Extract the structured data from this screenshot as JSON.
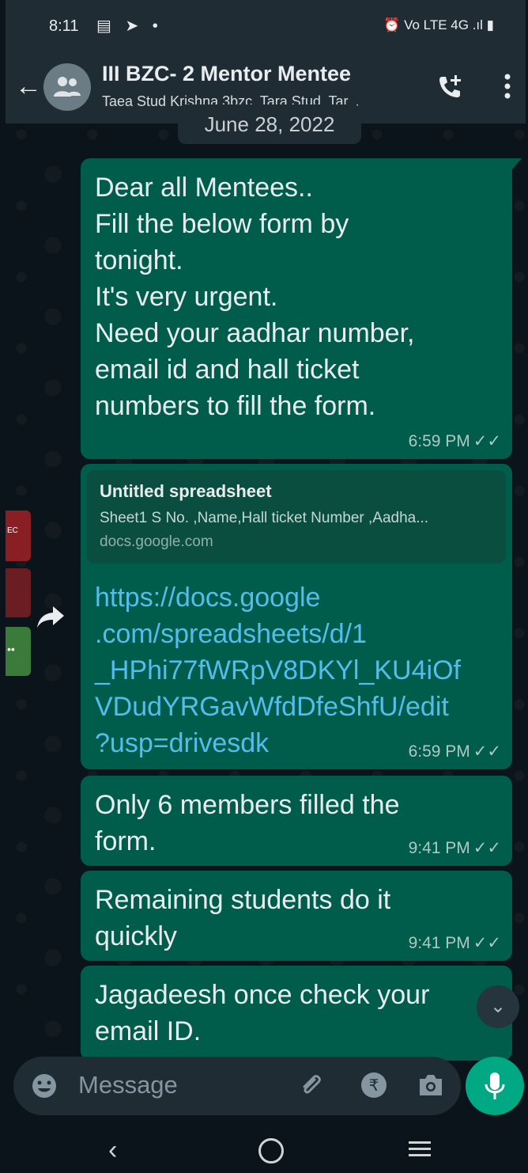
{
  "status_bar": {
    "time": "8:11",
    "left_icons": "▤ ➤ •",
    "right_icons": "⏰ Vo LTE 4G .ıl ▮"
  },
  "header": {
    "title": "III BZC- 2 Mentor Mentee",
    "subtitle": "Taea Stud Krishna 3bzc, Tara Stud, Tar..."
  },
  "date_chip": "June 28, 2022",
  "messages": [
    {
      "text": "Dear all Mentees..\nFill the below form by\ntonight.\nIt's very urgent.\nNeed your aadhar number,\nemail id and hall ticket\nnumbers to fill the form.",
      "time": "6:59 PM"
    },
    {
      "preview_title": "Untitled spreadsheet",
      "preview_desc": "Sheet1 S No. ,Name,Hall ticket Number ,Aadha...",
      "preview_domain": "docs.google.com",
      "link": "https://docs.google\n.com/spreadsheets/d/1\n_HPhi77fWRpV8DKYl_KU4iOf\nVDudYRGavWfdDfeShfU/edit\n?usp=drivesdk",
      "time": "6:59 PM"
    },
    {
      "text": "Only 6 members filled the\nform.",
      "time": "9:41 PM"
    },
    {
      "text": "Remaining students do it\nquickly",
      "time": "9:41 PM"
    },
    {
      "text": "Jagadeesh once check your\nemail ID.",
      "time": ""
    }
  ],
  "side_widget": {
    "rec_label": "EC"
  },
  "input": {
    "placeholder": "Message"
  },
  "colors": {
    "outgoing_bubble": "#005c4b",
    "header_bg": "#1f2c34",
    "accent": "#00a884",
    "link": "#53bdeb"
  }
}
